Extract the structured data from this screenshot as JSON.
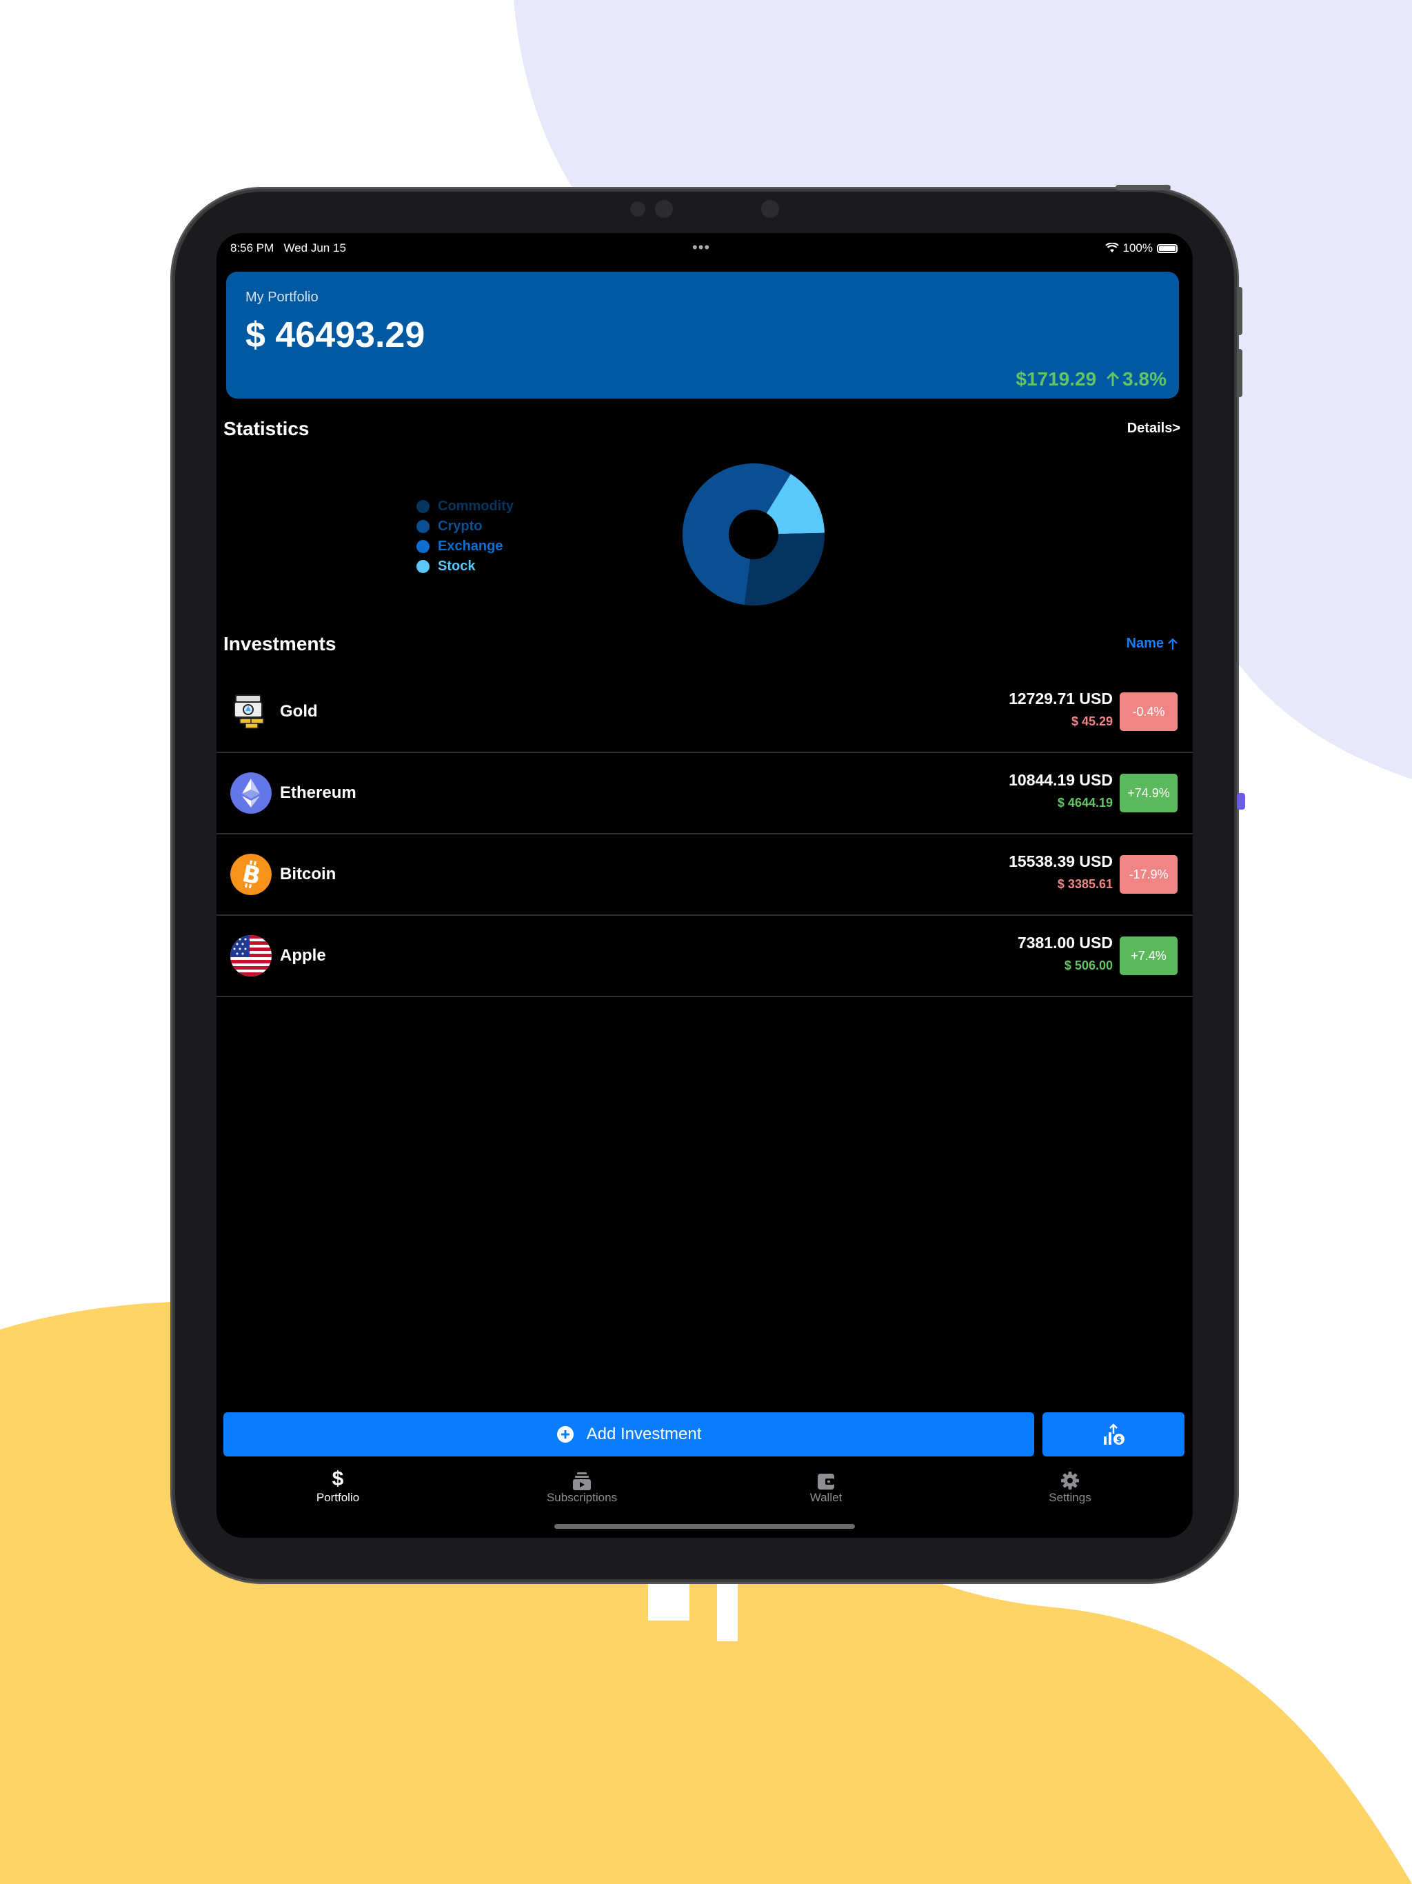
{
  "status_bar": {
    "time": "8:56 PM",
    "date": "Wed Jun 15",
    "battery": "100%"
  },
  "portfolio": {
    "label": "My Portfolio",
    "total": "$ 46493.29",
    "change_amount": "$1719.29",
    "change_percent": "3.8%"
  },
  "statistics": {
    "title": "Statistics",
    "details_label": "Details>",
    "legend": [
      {
        "label": "Commodity",
        "color": "#063460"
      },
      {
        "label": "Crypto",
        "color": "#0b4f92"
      },
      {
        "label": "Exchange",
        "color": "#0f6fd0"
      },
      {
        "label": "Stock",
        "color": "#5ac8fa"
      }
    ]
  },
  "chart_data": {
    "type": "pie",
    "categories": [
      "Stock",
      "Commodity",
      "Crypto"
    ],
    "values": [
      15.9,
      27.4,
      56.7
    ],
    "colors": [
      "#5ac8fa",
      "#063460",
      "#0b4f92"
    ],
    "donut": true
  },
  "investments": {
    "title": "Investments",
    "sort_label": "Name",
    "items": [
      {
        "name": "Gold",
        "value": "12729.71 USD",
        "diff": "$ 45.29",
        "pct": "-0.4%",
        "positive": false
      },
      {
        "name": "Ethereum",
        "value": "10844.19 USD",
        "diff": "$ 4644.19",
        "pct": "+74.9%",
        "positive": true
      },
      {
        "name": "Bitcoin",
        "value": "15538.39 USD",
        "diff": "$ 3385.61",
        "pct": "-17.9%",
        "positive": false
      },
      {
        "name": "Apple",
        "value": "7381.00 USD",
        "diff": "$ 506.00",
        "pct": "+7.4%",
        "positive": true
      }
    ]
  },
  "actions": {
    "add_label": "Add Investment"
  },
  "tabs": [
    {
      "label": "Portfolio",
      "icon": "dollar-icon"
    },
    {
      "label": "Subscriptions",
      "icon": "subscriptions-icon"
    },
    {
      "label": "Wallet",
      "icon": "wallet-icon"
    },
    {
      "label": "Settings",
      "icon": "gear-icon"
    }
  ],
  "colors": {
    "card": "#0059a1",
    "accent": "#0a7cff",
    "positive": "#62c462",
    "negative": "#ef8584",
    "pct_positive_bg": "#5cb85c",
    "pct_negative_bg": "#ef8585"
  }
}
